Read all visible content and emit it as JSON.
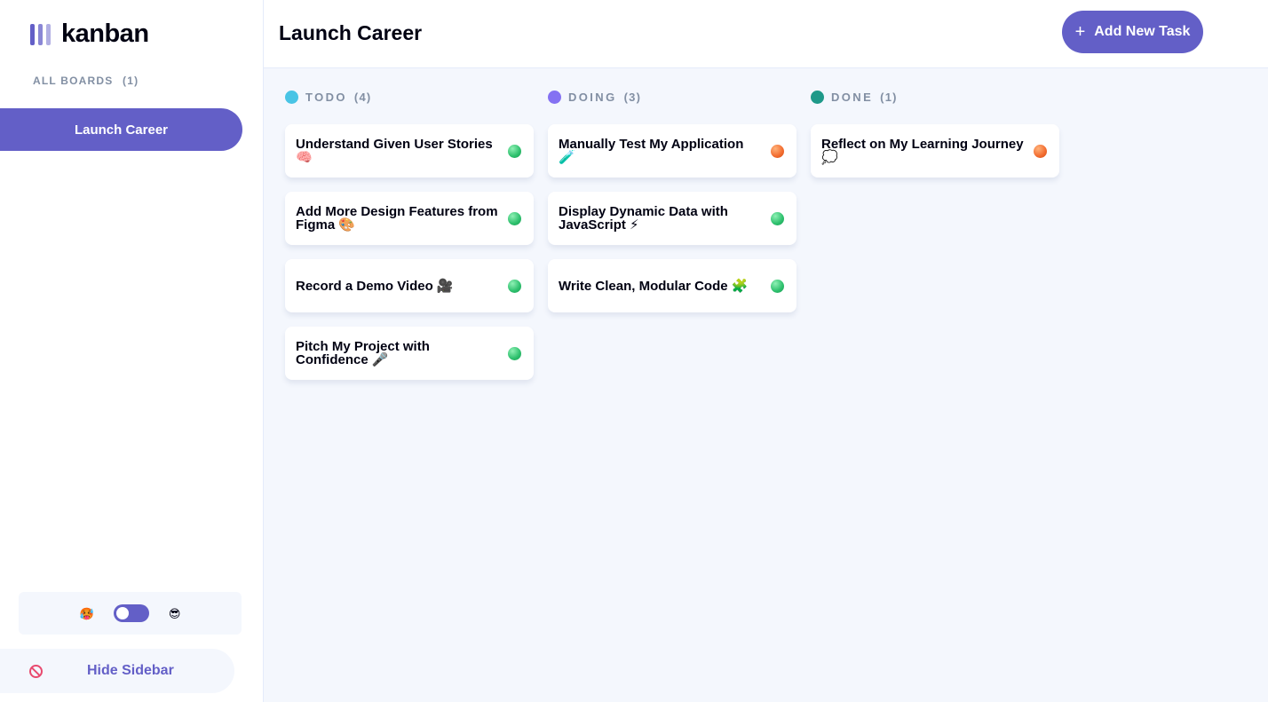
{
  "sidebar": {
    "logo_text": "kanban",
    "boards_heading": "ALL BOARDS",
    "boards_count": "(1)",
    "boards": [
      {
        "label": "Launch Career",
        "active": true
      }
    ],
    "theme": {
      "light_icon": "🥵",
      "dark_icon": "😎"
    },
    "hide_label": "Hide Sidebar"
  },
  "header": {
    "title": "Launch Career",
    "add_task_icon": "+",
    "add_task_label": "Add New Task"
  },
  "columns": [
    {
      "name": "TODO",
      "count": "(4)",
      "color": "#49c4e5",
      "cards": [
        {
          "title": "Understand Given User Stories 🧠",
          "status": "green"
        },
        {
          "title": "Add More Design Features from Figma 🎨",
          "status": "green"
        },
        {
          "title": "Record a Demo Video 🎥",
          "status": "green"
        },
        {
          "title": "Pitch My Project with Confidence 🎤",
          "status": "green"
        }
      ]
    },
    {
      "name": "DOING",
      "count": "(3)",
      "color": "#8471f2",
      "cards": [
        {
          "title": "Manually Test My Application 🧪",
          "status": "orange"
        },
        {
          "title": "Display Dynamic Data with JavaScript ⚡",
          "status": "green"
        },
        {
          "title": "Write Clean, Modular Code 🧩",
          "status": "green"
        }
      ]
    },
    {
      "name": "DONE",
      "count": "(1)",
      "color": "#1e9989",
      "cards": [
        {
          "title": "Reflect on My Learning Journey 💭",
          "status": "orange"
        }
      ]
    }
  ],
  "colors": {
    "accent": "#635fc7",
    "status_green": "#2cbf6c",
    "status_orange": "#f26b2e"
  }
}
